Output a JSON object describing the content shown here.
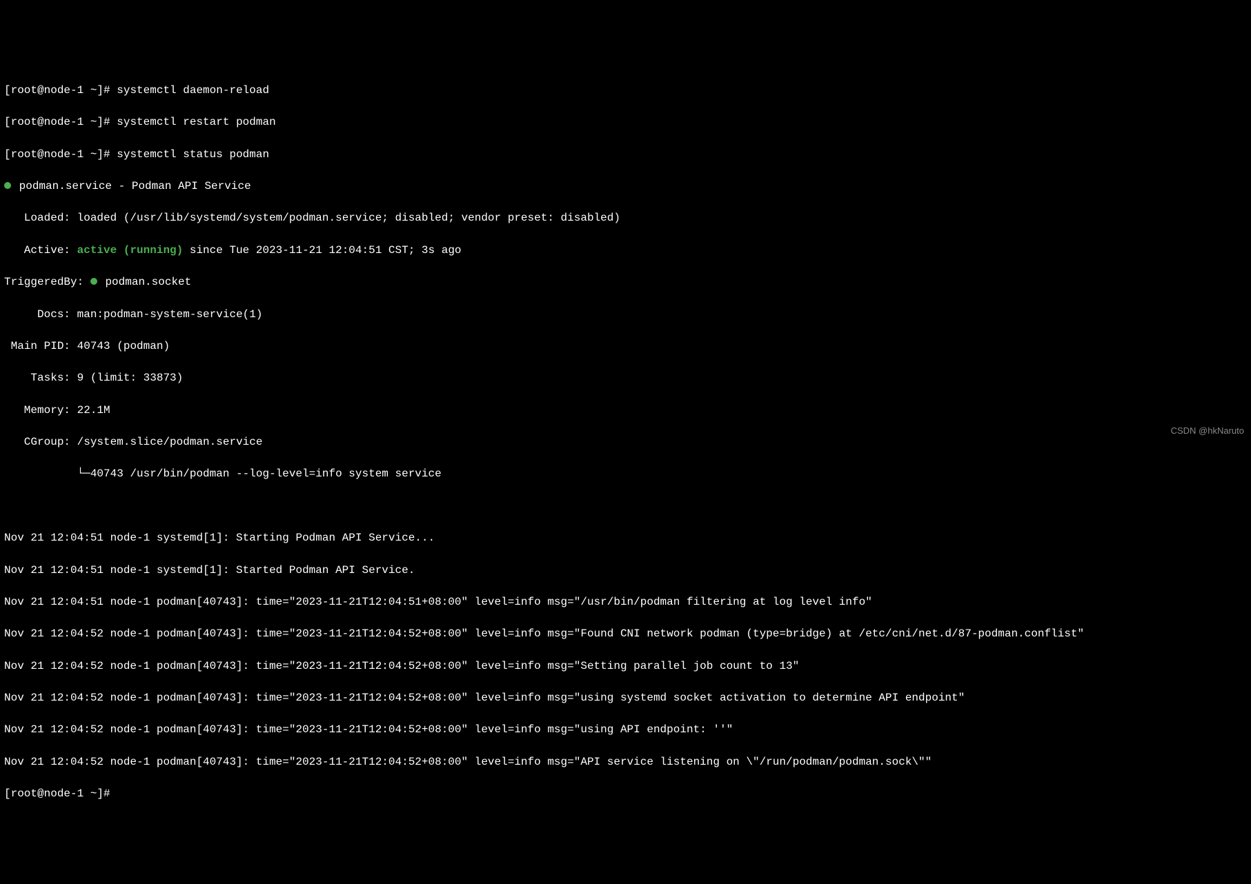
{
  "prompts": [
    {
      "prompt": "[root@node-1 ~]# ",
      "cmd": "systemctl daemon-reload"
    },
    {
      "prompt": "[root@node-1 ~]# ",
      "cmd": "systemctl restart podman"
    },
    {
      "prompt": "[root@node-1 ~]# ",
      "cmd": "systemctl status podman"
    }
  ],
  "service": {
    "unit_line": "podman.service - Podman API Service",
    "loaded_label": "   Loaded: ",
    "loaded_value": "loaded (/usr/lib/systemd/system/podman.service; disabled; vendor preset: disabled)",
    "active_label": "   Active: ",
    "active_state": "active (running)",
    "active_since": " since Tue 2023-11-21 12:04:51 CST; 3s ago",
    "triggeredby_label": "TriggeredBy: ",
    "triggeredby_value": "podman.socket",
    "docs_label": "     Docs: ",
    "docs_value": "man:podman-system-service(1)",
    "mainpid_label": " Main PID: ",
    "mainpid_value": "40743 (podman)",
    "tasks_label": "    Tasks: ",
    "tasks_value": "9 (limit: 33873)",
    "memory_label": "   Memory: ",
    "memory_value": "22.1M",
    "cgroup_label": "   CGroup: ",
    "cgroup_value": "/system.slice/podman.service",
    "cgroup_tree": "           └─",
    "cgroup_proc": "40743 /usr/bin/podman --log-level=info system service"
  },
  "logs": [
    "Nov 21 12:04:51 node-1 systemd[1]: Starting Podman API Service...",
    "Nov 21 12:04:51 node-1 systemd[1]: Started Podman API Service.",
    "Nov 21 12:04:51 node-1 podman[40743]: time=\"2023-11-21T12:04:51+08:00\" level=info msg=\"/usr/bin/podman filtering at log level info\"",
    "Nov 21 12:04:52 node-1 podman[40743]: time=\"2023-11-21T12:04:52+08:00\" level=info msg=\"Found CNI network podman (type=bridge) at /etc/cni/net.d/87-podman.conflist\"",
    "Nov 21 12:04:52 node-1 podman[40743]: time=\"2023-11-21T12:04:52+08:00\" level=info msg=\"Setting parallel job count to 13\"",
    "Nov 21 12:04:52 node-1 podman[40743]: time=\"2023-11-21T12:04:52+08:00\" level=info msg=\"using systemd socket activation to determine API endpoint\"",
    "Nov 21 12:04:52 node-1 podman[40743]: time=\"2023-11-21T12:04:52+08:00\" level=info msg=\"using API endpoint: ''\"",
    "Nov 21 12:04:52 node-1 podman[40743]: time=\"2023-11-21T12:04:52+08:00\" level=info msg=\"API service listening on \\\"/run/podman/podman.sock\\\"\""
  ],
  "trailing_prompt": "[root@node-1 ~]#",
  "watermark": "CSDN @hkNaruto"
}
